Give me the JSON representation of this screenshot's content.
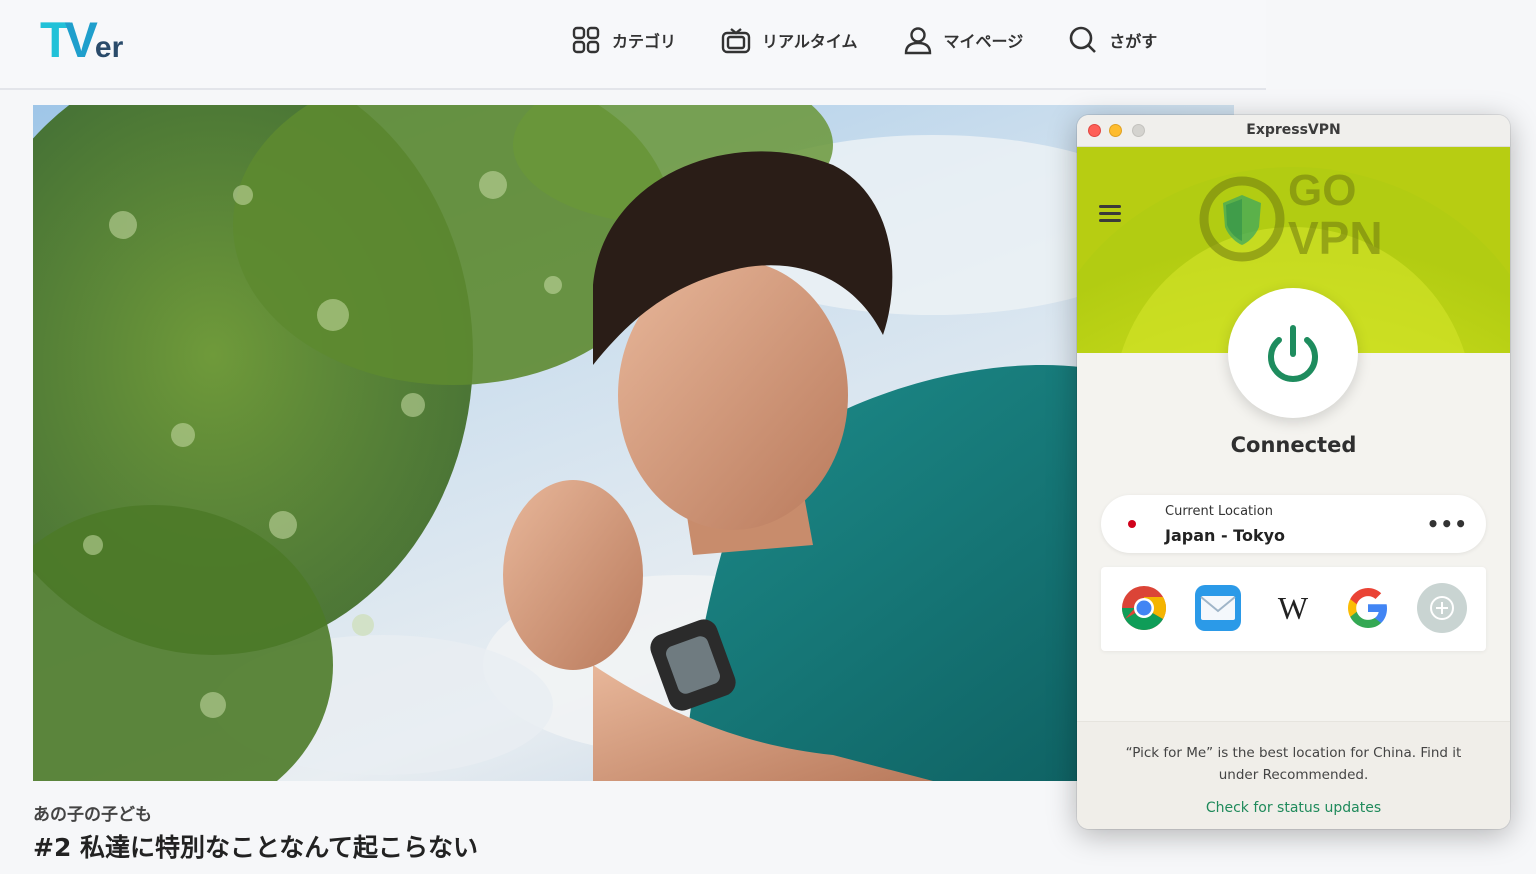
{
  "tver": {
    "logo": {
      "t": "T",
      "v": "V",
      "er": "er"
    },
    "nav": {
      "category": "カテゴリ",
      "realtime": "リアルタイム",
      "mypage": "マイページ",
      "search": "さがす"
    },
    "show": {
      "series": "あの子の子ども",
      "episode_title": "#2 私達に特別なことなんて起こらない"
    }
  },
  "vpn": {
    "window_title": "ExpressVPN",
    "watermark": {
      "line1": "GO",
      "line2": "VPN"
    },
    "status": "Connected",
    "location": {
      "label": "Current Location",
      "value": "Japan - Tokyo",
      "flag_color": "#d0021b"
    },
    "more_label": "•••",
    "shortcuts": [
      "chrome-icon",
      "mail-icon",
      "wikipedia-icon",
      "google-icon",
      "add-shortcut-icon"
    ],
    "footer": {
      "text": "“Pick for Me” is the best location for China. Find it under Recommended.",
      "link": "Check for status updates"
    },
    "colors": {
      "accent_green": "#1e8c5e",
      "hero_lime": "#c8d90f",
      "link_green": "#1f8a5b"
    }
  }
}
